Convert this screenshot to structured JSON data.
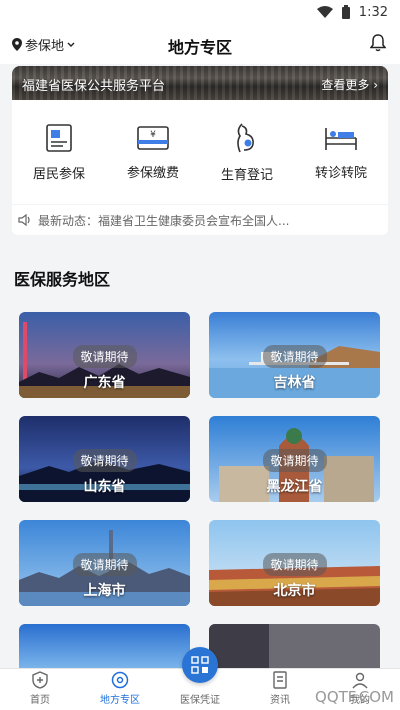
{
  "status": {
    "time": "1:32"
  },
  "header": {
    "location": "参保地",
    "title": "地方专区"
  },
  "banner": {
    "title": "福建省医保公共服务平台",
    "more": "查看更多"
  },
  "services": [
    {
      "label": "居民参保",
      "icon": "resident-insurance-icon"
    },
    {
      "label": "参保缴费",
      "icon": "payment-icon"
    },
    {
      "label": "生育登记",
      "icon": "maternity-icon"
    },
    {
      "label": "转诊转院",
      "icon": "hospital-bed-icon"
    }
  ],
  "news": {
    "text": "最新动态：福建省卫生健康委员会宣布全国人..."
  },
  "section": {
    "title": "医保服务地区"
  },
  "regions": [
    {
      "name": "广东省",
      "badge": "敬请期待"
    },
    {
      "name": "吉林省",
      "badge": "敬请期待"
    },
    {
      "name": "山东省",
      "badge": "敬请期待"
    },
    {
      "name": "黑龙江省",
      "badge": "敬请期待"
    },
    {
      "name": "上海市",
      "badge": "敬请期待"
    },
    {
      "name": "北京市",
      "badge": "敬请期待"
    }
  ],
  "tabs": [
    {
      "label": "首页"
    },
    {
      "label": "地方专区"
    },
    {
      "label": "医保凭证"
    },
    {
      "label": "资讯"
    },
    {
      "label": "我的"
    }
  ],
  "watermark": "QQTF.COM",
  "colors": {
    "accent": "#1e6fd9",
    "qr_button": "#2a74d6"
  }
}
